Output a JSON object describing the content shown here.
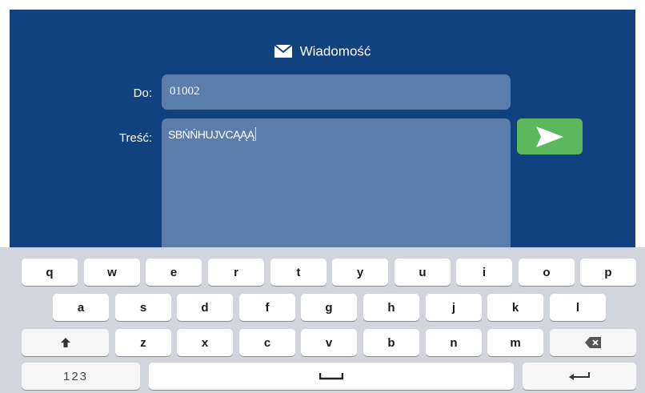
{
  "header": {
    "title": "Wiadomość",
    "icon": "envelope-icon"
  },
  "form": {
    "to_label": "Do:",
    "to_value": "01002",
    "body_label": "Treść:",
    "body_value": "SBŃŃHUJVCĄĄĄ"
  },
  "send_button": {
    "icon": "send-arrow-icon",
    "color": "#5cb85c"
  },
  "keyboard": {
    "row1": [
      "q",
      "w",
      "e",
      "r",
      "t",
      "y",
      "u",
      "i",
      "o",
      "p"
    ],
    "row2": [
      "a",
      "s",
      "d",
      "f",
      "g",
      "h",
      "j",
      "k",
      "l"
    ],
    "row3": [
      "z",
      "x",
      "c",
      "v",
      "b",
      "n",
      "m"
    ],
    "numbers_label": "123",
    "shift_icon": "shift-up-arrow-icon",
    "backspace_icon": "backspace-icon",
    "space_icon": "space-bar-icon",
    "enter_icon": "return-arrow-icon"
  },
  "colors": {
    "background": "#11427f",
    "field": "#5b7dab",
    "keyboard": "#d2d5db"
  }
}
